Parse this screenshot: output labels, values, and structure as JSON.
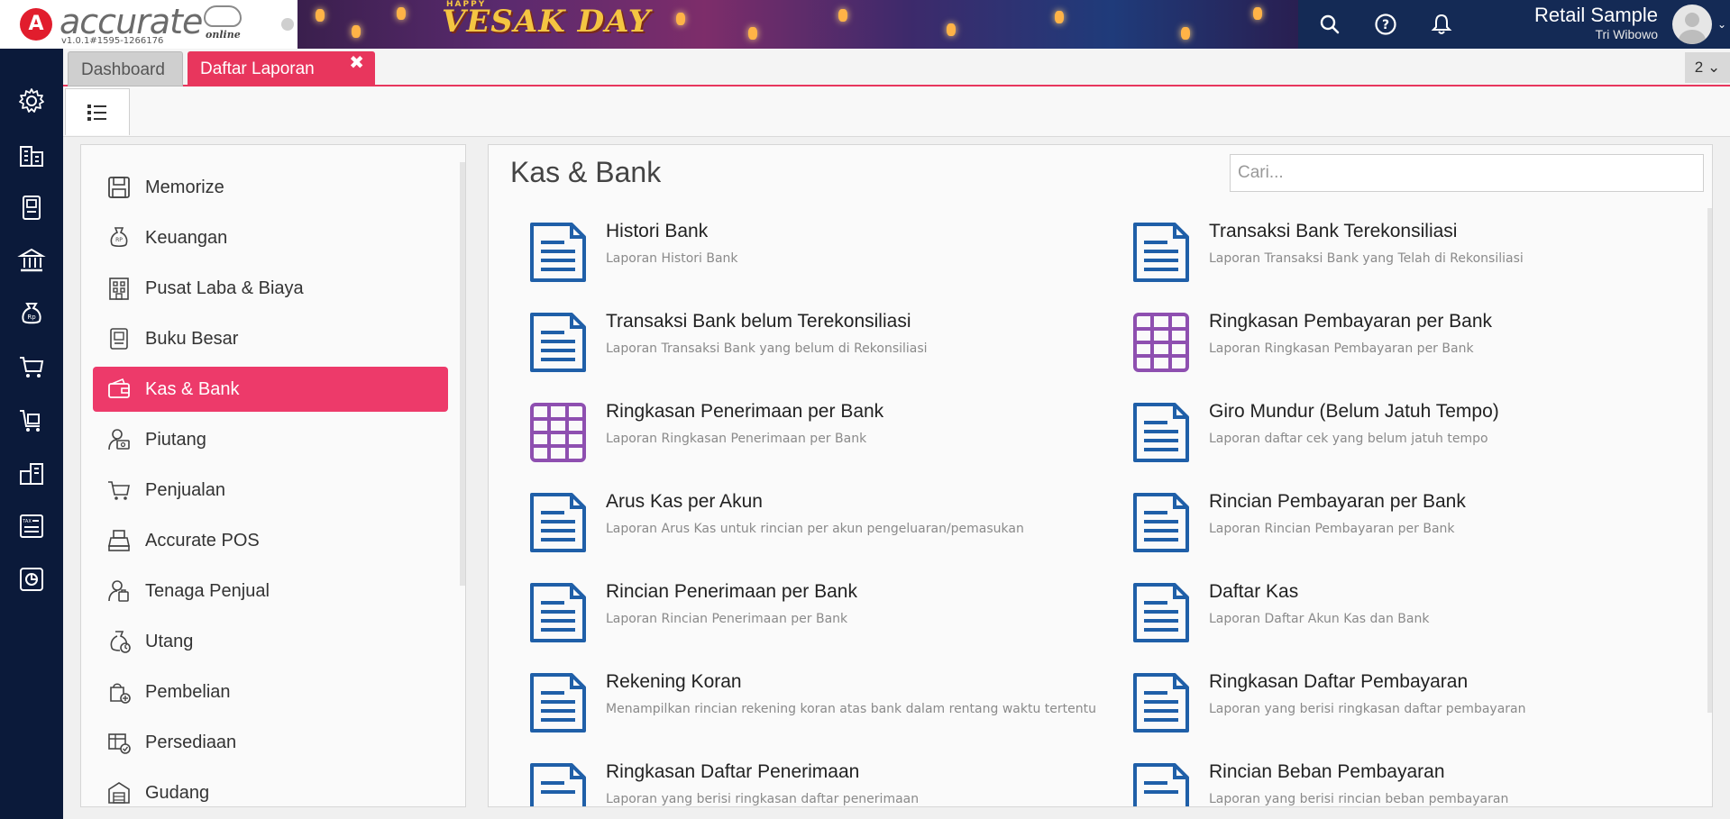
{
  "header": {
    "logo_text": "accurate",
    "logo_sub": "online",
    "version": "v1.0.1#1595-1266176",
    "banner_happy": "HAPPY",
    "banner_title": "VESAK DAY",
    "company": "Retail Sample",
    "user": "Tri Wibowo"
  },
  "tabs": {
    "dashboard": "Dashboard",
    "daftar": "Daftar Laporan",
    "close": "✖",
    "counter": "2 ⌄"
  },
  "categories": [
    {
      "label": "Memorize",
      "icon": "save-icon"
    },
    {
      "label": "Keuangan",
      "icon": "money-bag-icon"
    },
    {
      "label": "Pusat Laba & Biaya",
      "icon": "building-grid-icon"
    },
    {
      "label": "Buku Besar",
      "icon": "ledger-book-icon"
    },
    {
      "label": "Kas & Bank",
      "icon": "wallet-icon",
      "active": true
    },
    {
      "label": "Piutang",
      "icon": "receivable-icon"
    },
    {
      "label": "Penjualan",
      "icon": "cart-icon"
    },
    {
      "label": "Accurate POS",
      "icon": "cash-register-icon"
    },
    {
      "label": "Tenaga Penjual",
      "icon": "salesperson-icon"
    },
    {
      "label": "Utang",
      "icon": "debt-bag-icon"
    },
    {
      "label": "Pembelian",
      "icon": "purchase-bag-icon"
    },
    {
      "label": "Persediaan",
      "icon": "inventory-icon"
    },
    {
      "label": "Gudang",
      "icon": "warehouse-icon"
    }
  ],
  "report_section": {
    "title": "Kas & Bank",
    "search_placeholder": "Cari..."
  },
  "reports": [
    {
      "name": "Histori Bank",
      "desc": "Laporan Histori Bank",
      "icon": "document-icon"
    },
    {
      "name": "Transaksi Bank Terekonsiliasi",
      "desc": "Laporan Transaksi Bank yang Telah di Rekonsiliasi",
      "icon": "document-icon"
    },
    {
      "name": "Transaksi Bank belum Terekonsiliasi",
      "desc": "Laporan Transaksi Bank yang belum di Rekonsiliasi",
      "icon": "document-icon"
    },
    {
      "name": "Ringkasan Pembayaran per Bank",
      "desc": "Laporan Ringkasan Pembayaran per Bank",
      "icon": "grid-table-icon"
    },
    {
      "name": "Ringkasan Penerimaan per Bank",
      "desc": "Laporan Ringkasan Penerimaan per Bank",
      "icon": "grid-table-icon"
    },
    {
      "name": "Giro Mundur (Belum Jatuh Tempo)",
      "desc": "Laporan daftar cek yang belum jatuh tempo",
      "icon": "document-icon"
    },
    {
      "name": "Arus Kas per Akun",
      "desc": "Laporan Arus Kas untuk rincian per akun pengeluaran/pemasukan",
      "icon": "document-icon"
    },
    {
      "name": "Rincian Pembayaran per Bank",
      "desc": "Laporan Rincian Pembayaran per Bank",
      "icon": "document-icon"
    },
    {
      "name": "Rincian Penerimaan per Bank",
      "desc": "Laporan Rincian Penerimaan per Bank",
      "icon": "document-icon"
    },
    {
      "name": "Daftar Kas",
      "desc": "Laporan Daftar Akun Kas dan Bank",
      "icon": "document-icon"
    },
    {
      "name": "Rekening Koran",
      "desc": "Menampilkan rincian rekening koran atas bank dalam rentang waktu tertentu",
      "icon": "document-icon"
    },
    {
      "name": "Ringkasan Daftar Pembayaran",
      "desc": "Laporan yang berisi ringkasan daftar pembayaran",
      "icon": "document-icon"
    },
    {
      "name": "Ringkasan Daftar Penerimaan",
      "desc": "Laporan yang berisi ringkasan daftar penerimaan",
      "icon": "document-icon"
    },
    {
      "name": "Rincian Beban Pembayaran",
      "desc": "Laporan yang berisi rincian beban pembayaran",
      "icon": "document-icon"
    }
  ],
  "colors": {
    "accent": "#e8365d",
    "navy": "#0b1a3a",
    "doc_icon": "#1f5fa8",
    "grid_icon": "#8e4fb0"
  }
}
